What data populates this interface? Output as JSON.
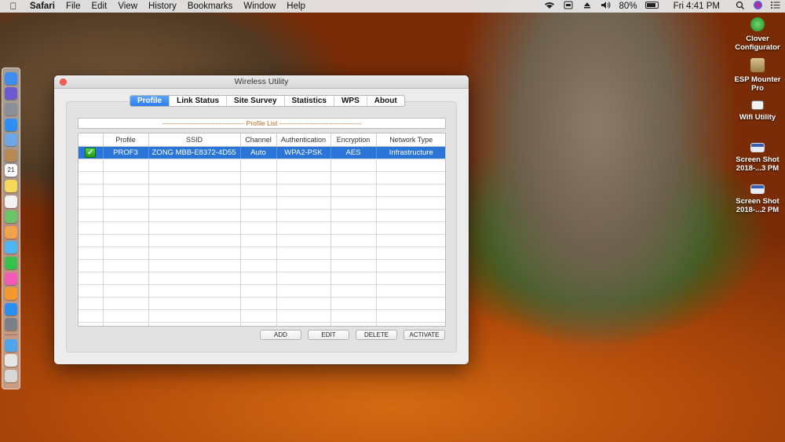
{
  "menubar": {
    "apple_glyph": "",
    "items": [
      "Safari",
      "File",
      "Edit",
      "View",
      "History",
      "Bookmarks",
      "Window",
      "Help"
    ],
    "battery_percent": "80%",
    "clock": "Fri 4:41 PM"
  },
  "desktop": {
    "icons": [
      {
        "label": "Clover Configurator",
        "icon": "clover-icon",
        "color": "#2aa02a"
      },
      {
        "label": "ESP Mounter Pro",
        "icon": "esp-mounter-icon",
        "color": "#b59a6a"
      },
      {
        "label": "Wifi Utility",
        "icon": "wifi-utility-icon",
        "color": "#f4f4f4"
      },
      {
        "label": "Screen Shot 2018-...3 PM",
        "icon": "screenshot-file-icon",
        "color": "#dfe6f0"
      },
      {
        "label": "Screen Shot 2018-...2 PM",
        "icon": "screenshot-file-icon",
        "color": "#dfe6f0"
      }
    ]
  },
  "dock": {
    "apps": [
      {
        "name": "finder-icon",
        "color": "#3d8ef0"
      },
      {
        "name": "siri-icon",
        "color": "#6b5ad0"
      },
      {
        "name": "launchpad-icon",
        "color": "#8a8f98"
      },
      {
        "name": "safari-icon",
        "color": "#2f8ef5"
      },
      {
        "name": "mail-icon",
        "color": "#6ea7e8"
      },
      {
        "name": "contacts-icon",
        "color": "#b78a55"
      },
      {
        "name": "calendar-icon",
        "color": "#ffffff"
      },
      {
        "name": "notes-icon",
        "color": "#f7d85a"
      },
      {
        "name": "reminders-icon",
        "color": "#f2f2f2"
      },
      {
        "name": "maps-icon",
        "color": "#6cc46a"
      },
      {
        "name": "photos-icon",
        "color": "#f4a14b"
      },
      {
        "name": "messages-icon",
        "color": "#4fb6f5"
      },
      {
        "name": "facetime-icon",
        "color": "#36c24c"
      },
      {
        "name": "itunes-icon",
        "color": "#f25ab6"
      },
      {
        "name": "ibooks-icon",
        "color": "#f49a2c"
      },
      {
        "name": "app-store-icon",
        "color": "#2b8ff2"
      },
      {
        "name": "system-preferences-icon",
        "color": "#7b7f86"
      }
    ],
    "extras": [
      {
        "name": "downloads-folder-icon",
        "color": "#4ea5ea"
      },
      {
        "name": "documents-stack-icon",
        "color": "#e6e6e6"
      },
      {
        "name": "trash-icon",
        "color": "#d8d8d8"
      }
    ],
    "calendar_day": "21"
  },
  "window": {
    "title": "Wireless Utility",
    "tabs": [
      "Profile",
      "Link Status",
      "Site Survey",
      "Statistics",
      "WPS",
      "About"
    ],
    "active_tab": "Profile",
    "profile_list_title": "------------------------------------- Profile List -------------------------------------",
    "table": {
      "columns": [
        "",
        "Profile",
        "SSID",
        "Channel",
        "Authentication",
        "Encryption",
        "Network Type"
      ],
      "rows": [
        {
          "active": true,
          "profile": "PROF3",
          "ssid": "ZONG MBB-E8372-4D55",
          "channel": "Auto",
          "authentication": "WPA2-PSK",
          "encryption": "AES",
          "network_type": "Infrastructure"
        }
      ],
      "empty_rows": 14
    },
    "buttons": [
      "ADD",
      "EDIT",
      "DELETE",
      "ACTIVATE"
    ]
  },
  "colors": {
    "accent_blue": "#2b74d8",
    "tab_active": "#2a7cf2",
    "close_red": "#fc5e57",
    "profile_list_text": "#b06a1e"
  }
}
